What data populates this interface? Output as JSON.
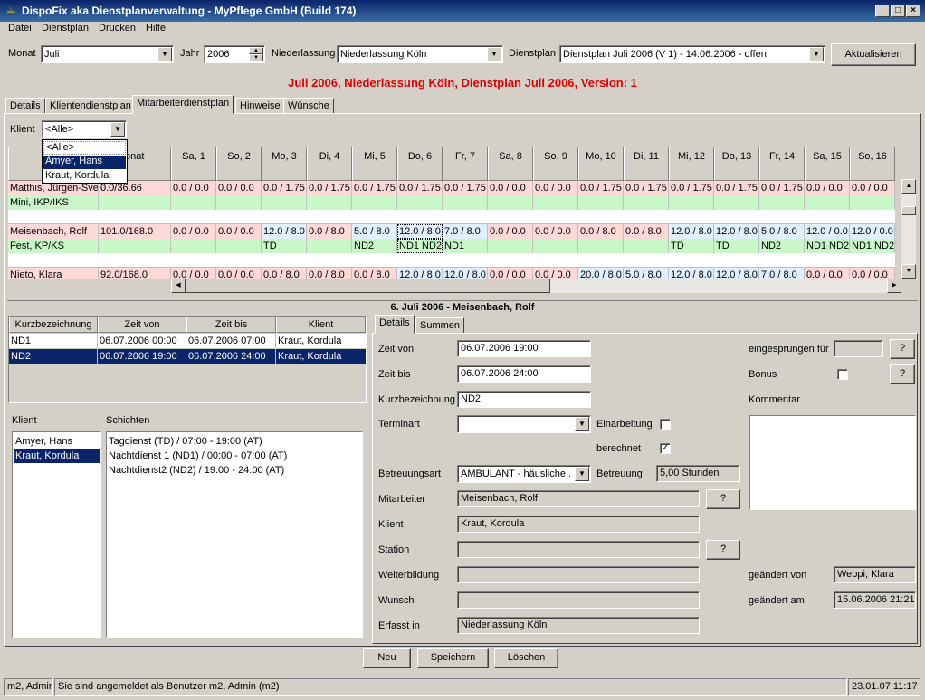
{
  "window": {
    "title": "DispoFix aka Dienstplanverwaltung - MyPflege GmbH (Build 174)"
  },
  "menu": [
    "Datei",
    "Dienstplan",
    "Drucken",
    "Hilfe"
  ],
  "toolbar": {
    "monat_label": "Monat",
    "monat": "Juli",
    "jahr_label": "Jahr",
    "jahr": "2006",
    "niederlassung_label": "Niederlassung",
    "niederlassung": "Niederlassung Köln",
    "dienstplan_label": "Dienstplan",
    "dienstplan": "Dienstplan Juli 2006 (V 1) - 14.06.2006 - offen",
    "refresh": "Aktualisieren"
  },
  "heading": "Juli 2006, Niederlassung Köln, Dienstplan Juli 2006, Version: 1",
  "tabs": [
    "Details",
    "Klientendienstplan",
    "Mitarbeiterdienstplan",
    "Hinweise",
    "Wünsche"
  ],
  "klient_filter": {
    "label": "Klient",
    "value": "<Alle>",
    "options": [
      "<Alle>",
      "Amyer, Hans",
      "Kraut, Kordula"
    ]
  },
  "grid": {
    "col_name": "Mi",
    "col_monat": "onat",
    "days": [
      "Sa, 1",
      "So, 2",
      "Mo, 3",
      "Di, 4",
      "Mi, 5",
      "Do, 6",
      "Fr, 7",
      "Sa, 8",
      "So, 9",
      "Mo, 10",
      "Di, 11",
      "Mi, 12",
      "Do, 13",
      "Fr, 14",
      "Sa, 15",
      "So, 16"
    ],
    "rows": [
      {
        "name": "Matthis, Jürgen-Sven",
        "type": "Mini, IKP/IKS",
        "monat": "0.0/36.66",
        "vals": [
          "0.0 / 0.0",
          "0.0 / 0.0",
          "0.0 / 1.75",
          "0.0 / 1.75",
          "0.0 / 1.75",
          "0.0 / 1.75",
          "0.0 / 1.75",
          "0.0 / 0.0",
          "0.0 / 0.0",
          "0.0 / 1.75",
          "0.0 / 1.75",
          "0.0 / 1.75",
          "0.0 / 1.75",
          "0.0 / 1.75",
          "0.0 / 0.0",
          "0.0 / 0.0"
        ],
        "codes": [
          "",
          "",
          "",
          "",
          "",
          "",
          "",
          "",
          "",
          "",
          "",
          "",
          "",
          "",
          "",
          ""
        ]
      },
      {
        "name": "Meisenbach, Rolf",
        "type": "Fest, KP/KS",
        "monat": "101.0/168.0",
        "vals": [
          "0.0 / 0.0",
          "0.0 / 0.0",
          "12.0 / 8.0",
          "0.0 / 8.0",
          "5.0 / 8.0",
          "12.0 / 8.0",
          "7.0 / 8.0",
          "0.0 / 0.0",
          "0.0 / 0.0",
          "0.0 / 8.0",
          "0.0 / 8.0",
          "12.0 / 8.0",
          "12.0 / 8.0",
          "5.0 / 8.0",
          "12.0 / 0.0",
          "12.0 / 0.0"
        ],
        "codes": [
          "",
          "",
          "TD",
          "",
          "ND2",
          "ND1 ND2",
          "ND1",
          "",
          "",
          "",
          "",
          "TD",
          "TD",
          "ND2",
          "ND1 ND2",
          "ND1 ND2"
        ]
      },
      {
        "name": "Nieto, Klara",
        "type": "",
        "monat": "92.0/168.0",
        "vals": [
          "0.0 / 0.0",
          "0.0 / 0.0",
          "0.0 / 8.0",
          "0.0 / 8.0",
          "0.0 / 8.0",
          "12.0 / 8.0",
          "12.0 / 8.0",
          "0.0 / 0.0",
          "0.0 / 0.0",
          "20.0 / 8.0",
          "5.0 / 8.0",
          "12.0 / 8.0",
          "12.0 / 8.0",
          "7.0 / 8.0",
          "0.0 / 0.0",
          "0.0 / 0.0"
        ],
        "codes": []
      }
    ]
  },
  "detail_title": "6. Juli 2006 - Meisenbach, Rolf",
  "shift_table": {
    "headers": [
      "Kurzbezeichnung",
      "Zeit von",
      "Zeit bis",
      "Klient"
    ],
    "rows": [
      [
        "ND1",
        "06.07.2006 00:00",
        "06.07.2006 07:00",
        "Kraut, Kordula"
      ],
      [
        "ND2",
        "06.07.2006 19:00",
        "06.07.2006 24:00",
        "Kraut, Kordula"
      ]
    ]
  },
  "klient_list": {
    "label": "Klient",
    "items": [
      "Amyer, Hans",
      "Kraut, Kordula"
    ]
  },
  "schichten": {
    "label": "Schichten",
    "items": [
      "Tagdienst (TD) / 07:00 - 19:00 (AT)",
      "Nachtdienst 1 (ND1) / 00:00 - 07:00 (AT)",
      "Nachtdienst2 (ND2) / 19:00 - 24:00 (AT)"
    ]
  },
  "detail_tabs": [
    "Details",
    "Summen"
  ],
  "form": {
    "zeit_von_label": "Zeit von",
    "zeit_von": "06.07.2006 19:00",
    "zeit_bis_label": "Zeit bis",
    "zeit_bis": "06.07.2006 24:00",
    "kurz_label": "Kurzbezeichnung",
    "kurz": "ND2",
    "terminart_label": "Terminart",
    "terminart": "",
    "einarbeitung_label": "Einarbeitung",
    "berechnet_label": "berechnet",
    "betreuungsart_label": "Betreuungsart",
    "betreuungsart": "AMBULANT - häusliche ...",
    "betreuung_label": "Betreuung",
    "betreuung": "5,00 Stunden",
    "mitarbeiter_label": "Mitarbeiter",
    "mitarbeiter": "Meisenbach, Rolf",
    "klient_label": "Klient",
    "klient": "Kraut, Kordula",
    "station_label": "Station",
    "station": "",
    "weiterbildung_label": "Weiterbildung",
    "weiterbildung": "",
    "wunsch_label": "Wunsch",
    "wunsch": "",
    "erfasst_label": "Erfasst in",
    "erfasst": "Niederlassung Köln",
    "eingesprungen_label": "eingesprungen für",
    "eingesprungen": "",
    "bonus_label": "Bonus",
    "kommentar_label": "Kommentar",
    "geaendert_von_label": "geändert von",
    "geaendert_von": "Weppi, Klara",
    "geaendert_am_label": "geändert am",
    "geaendert_am": "15.06.2006 21:21",
    "q": "?"
  },
  "actions": {
    "neu": "Neu",
    "speichern": "Speichern",
    "loeschen": "Löschen"
  },
  "status": {
    "user": "m2, Admin",
    "message": "Sie sind angemeldet als Benutzer m2, Admin (m2)",
    "time": "23.01.07 11:17"
  }
}
